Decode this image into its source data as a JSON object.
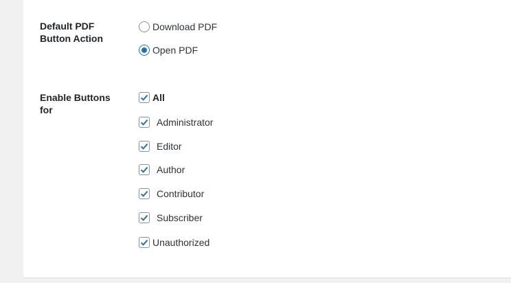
{
  "settings": {
    "pdf_action": {
      "label": "Default PDF Button Action",
      "options": [
        {
          "label": "Download PDF",
          "checked": false
        },
        {
          "label": "Open PDF",
          "checked": true
        }
      ]
    },
    "enable_buttons": {
      "label": "Enable Buttons for",
      "options": [
        {
          "label": "All",
          "checked": true
        },
        {
          "label": "Administrator",
          "checked": true
        },
        {
          "label": "Editor",
          "checked": true
        },
        {
          "label": "Author",
          "checked": true
        },
        {
          "label": "Contributor",
          "checked": true
        },
        {
          "label": "Subscriber",
          "checked": true
        },
        {
          "label": "Unauthorized",
          "checked": true
        }
      ]
    }
  },
  "colors": {
    "accent": "#2271b1",
    "background": "#f1f1f1",
    "panel": "#ffffff"
  }
}
